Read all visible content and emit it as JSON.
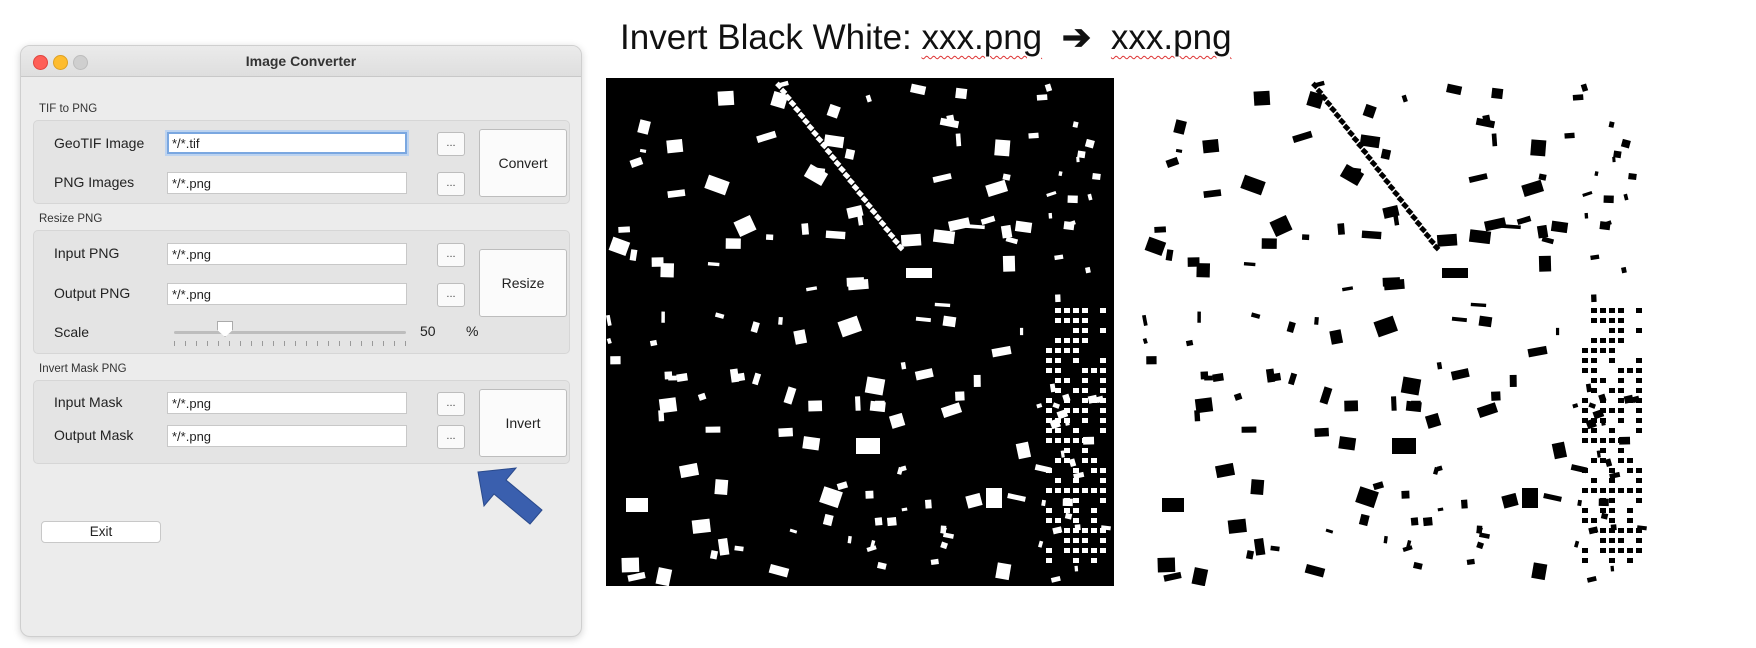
{
  "window": {
    "title": "Image Converter",
    "tif_section": {
      "title": "TIF to PNG",
      "geotif_label": "GeoTIF Image",
      "geotif_value": "*/*.tif",
      "png_label": "PNG Images",
      "png_value": "*/*.png",
      "browse_label": "...",
      "action_label": "Convert"
    },
    "resize_section": {
      "title": "Resize PNG",
      "input_label": "Input PNG",
      "input_value": "*/*.png",
      "output_label": "Output PNG",
      "output_value": "*/*.png",
      "browse_label": "...",
      "action_label": "Resize",
      "scale_label": "Scale",
      "scale_value": "50",
      "scale_unit": "%",
      "scale_fraction": 0.22
    },
    "invert_section": {
      "title": "Invert Mask PNG",
      "input_label": "Input Mask",
      "input_value": "*/*.png",
      "output_label": "Output Mask",
      "output_value": "*/*.png",
      "browse_label": "...",
      "action_label": "Invert"
    },
    "exit_label": "Exit"
  },
  "headline": {
    "prefix": "Invert Black White:",
    "source_file": "xxx.png",
    "arrow": "➔",
    "target_file": "xxx.png"
  },
  "colors": {
    "pointer_arrow": "#3a5fae",
    "focus_ring": "#7aa7e0",
    "close": "#fe5f57",
    "minimize": "#febc2e"
  },
  "icons": {
    "pointer": "arrow-pointing-up-left"
  }
}
